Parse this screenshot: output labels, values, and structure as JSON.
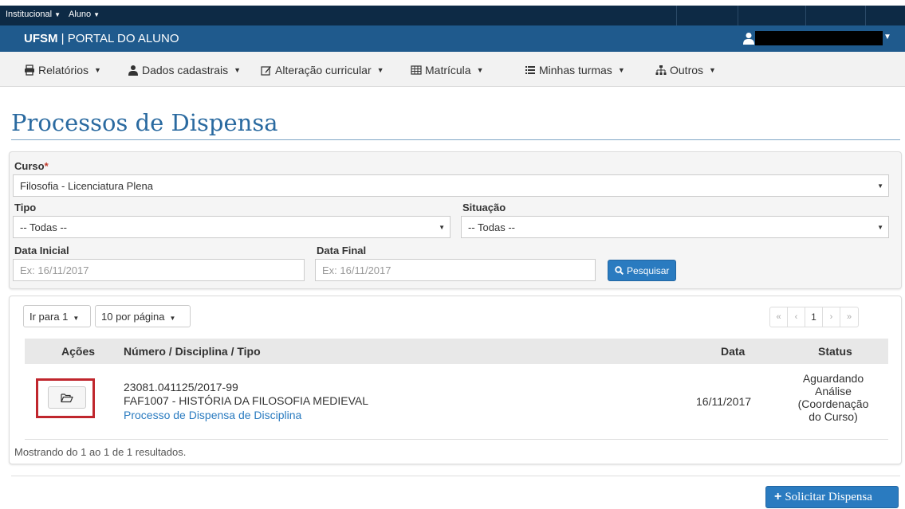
{
  "topbar": {
    "menus": [
      {
        "label": "Institucional"
      },
      {
        "label": "Aluno"
      }
    ]
  },
  "portal": {
    "brand": "UFSM",
    "separator": "|",
    "name": "PORTAL DO ALUNO"
  },
  "nav": {
    "items": [
      {
        "label": "Relatórios",
        "icon": "printer-icon"
      },
      {
        "label": "Dados cadastrais",
        "icon": "user-icon"
      },
      {
        "label": "Alteração curricular",
        "icon": "edit-icon"
      },
      {
        "label": "Matrícula",
        "icon": "table-icon"
      },
      {
        "label": "Minhas turmas",
        "icon": "list-icon"
      },
      {
        "label": "Outros",
        "icon": "sitemap-icon"
      }
    ]
  },
  "page": {
    "title": "Processos de Dispensa"
  },
  "filters": {
    "curso_label": "Curso",
    "curso_required": "*",
    "curso_value": "Filosofia - Licenciatura Plena",
    "tipo_label": "Tipo",
    "tipo_value": "-- Todas --",
    "situacao_label": "Situação",
    "situacao_value": "-- Todas --",
    "data_inicial_label": "Data Inicial",
    "data_inicial_placeholder": "Ex: 16/11/2017",
    "data_final_label": "Data Final",
    "data_final_placeholder": "Ex: 16/11/2017",
    "search_label": "Pesquisar"
  },
  "results": {
    "goto_label": "Ir para 1",
    "per_page_label": "10 por página",
    "pager": [
      "«",
      "‹",
      "1",
      "›",
      "»"
    ],
    "columns": {
      "acoes": "Ações",
      "numero": "Número / Disciplina / Tipo",
      "data": "Data",
      "status": "Status"
    },
    "rows": [
      {
        "numero": "23081.041125/2017-99",
        "disciplina": "FAF1007 - HISTÓRIA DA FILOSOFIA MEDIEVAL",
        "tipo": "Processo de Dispensa de Disciplina",
        "data": "16/11/2017",
        "status": [
          "Aguardando",
          "Análise",
          "(Coordenação",
          "do Curso)"
        ]
      }
    ],
    "summary": "Mostrando do 1 ao 1 de 1 resultados."
  },
  "actions": {
    "solicitar_label": "Solicitar Dispensa"
  },
  "colors": {
    "topbar": "#0d2a45",
    "portalbar": "#1f5a8d",
    "primary": "#2a7bc0",
    "title": "#2a6aa0",
    "highlight": "#c0262d"
  }
}
